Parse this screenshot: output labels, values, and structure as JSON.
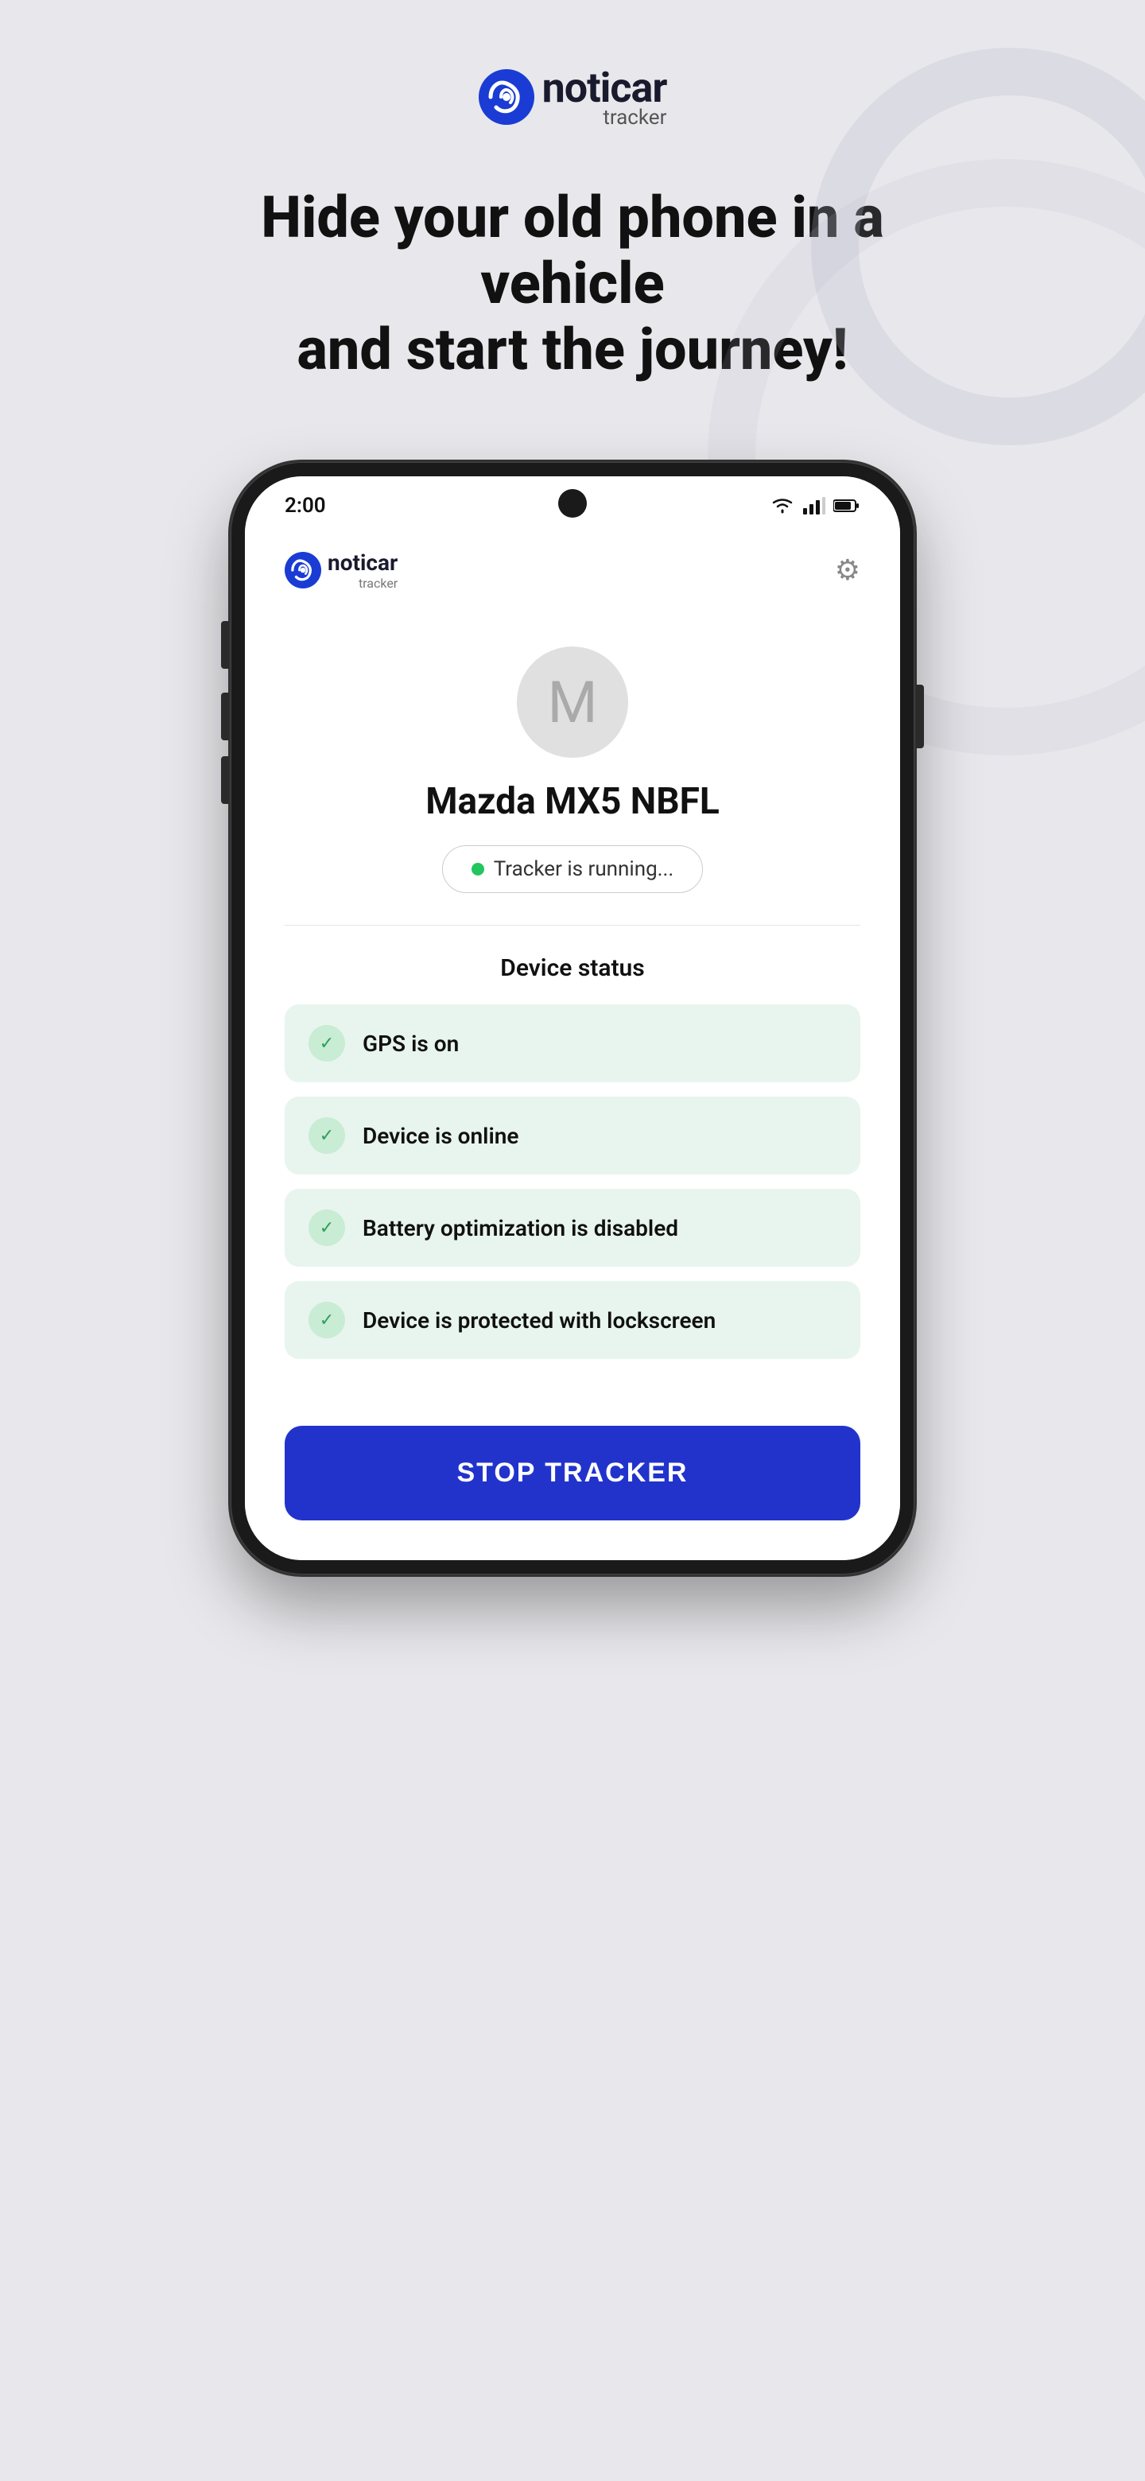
{
  "page": {
    "bg_color": "#e8e8ec"
  },
  "top_logo": {
    "icon_alt": "noticar logo",
    "brand": "noticar",
    "sub": "tracker"
  },
  "headline": {
    "line1": "Hide your old phone in a vehicle",
    "line2": "and start the journey!"
  },
  "phone": {
    "status_bar": {
      "time": "2:00"
    },
    "app_header": {
      "brand": "noticar",
      "sub": "tracker",
      "settings_icon": "⚙"
    },
    "vehicle": {
      "avatar_letter": "M",
      "name": "Mazda MX5 NBFL",
      "tracker_status": "Tracker is running..."
    },
    "device_status": {
      "title": "Device status",
      "items": [
        {
          "text": "GPS is on"
        },
        {
          "text": "Device is online"
        },
        {
          "text": "Battery optimization is disabled"
        },
        {
          "text": "Device is protected with lockscreen"
        }
      ]
    },
    "stop_button_label": "STOP TRACKER"
  }
}
